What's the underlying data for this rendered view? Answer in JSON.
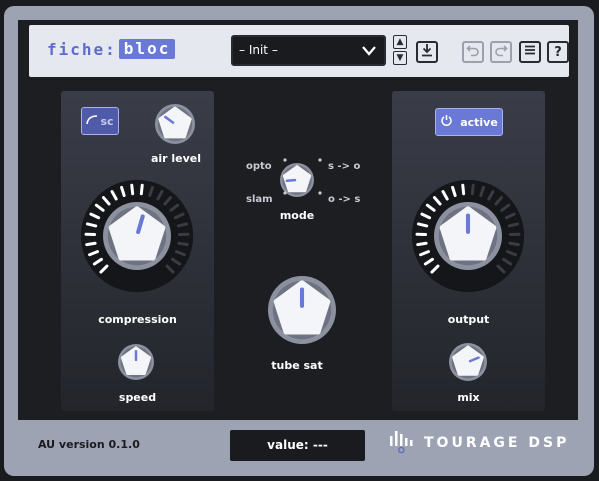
{
  "header": {
    "logo_part1": "fiche:",
    "logo_part2": "bloc",
    "preset_value": "– Init –",
    "preset_up": "▲",
    "preset_down": "▼",
    "help_label": "?"
  },
  "left_panel": {
    "sc_label": "sc",
    "air_level_label": "air level",
    "compression_label": "compression",
    "speed_label": "speed"
  },
  "center_panel": {
    "mode_label": "mode",
    "mode_options": {
      "opto": "opto",
      "slam": "slam",
      "s_to_o": "s -> o",
      "o_to_s": "o -> s"
    },
    "tube_sat_label": "tube sat"
  },
  "right_panel": {
    "active_label": "active",
    "output_label": "output",
    "mix_label": "mix"
  },
  "footer": {
    "version": "AU version 0.1.0",
    "value_readout": "value: ---",
    "brand": "TOURAGE DSP"
  },
  "colors": {
    "accent": "#6b79d6",
    "panel_dark": "#23252b",
    "frame": "#9ea3b3",
    "topbar": "#e6e8ef"
  },
  "knobs": {
    "air_level": 0.3,
    "compression": 0.56,
    "speed": 0.5,
    "mode": 0.15,
    "tube_sat": 0.5,
    "output": 0.5,
    "mix": 0.75
  }
}
